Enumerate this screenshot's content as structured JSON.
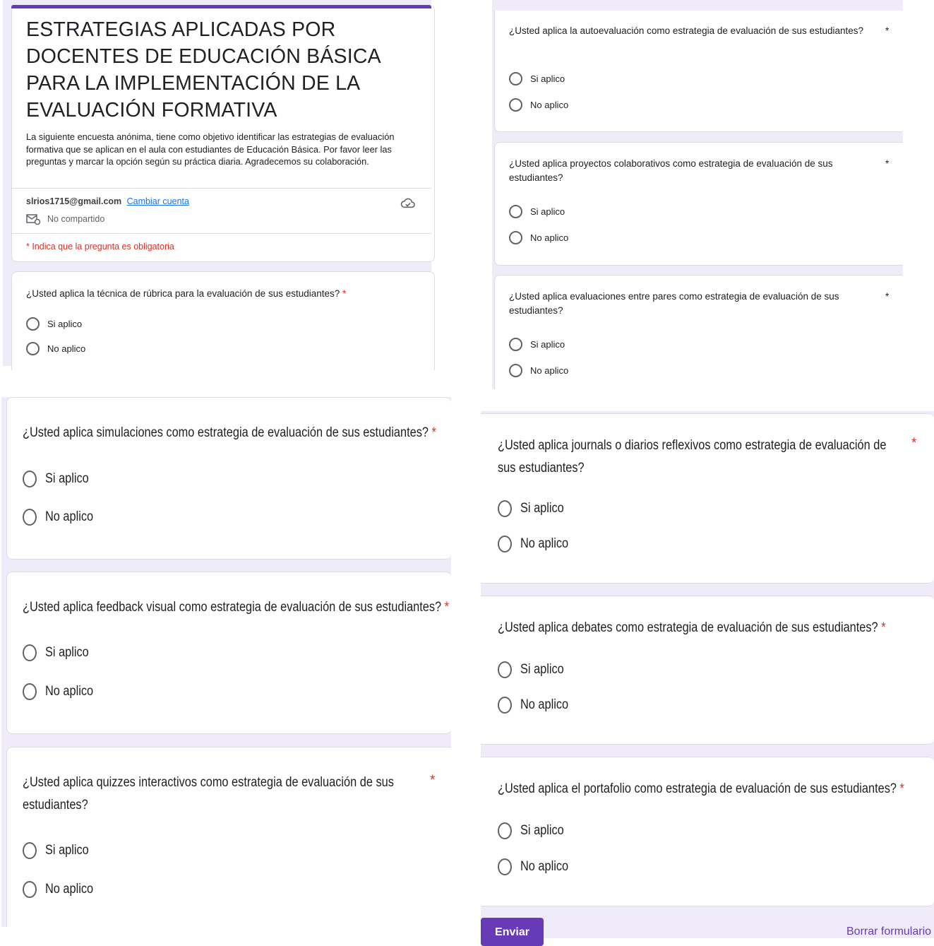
{
  "header": {
    "title": "ESTRATEGIAS APLICADAS POR DOCENTES DE EDUCACIÓN BÁSICA PARA LA IMPLEMENTACIÓN  DE LA EVALUACIÓN FORMATIVA",
    "description": "La siguiente encuesta anónima, tiene como  objetivo identificar las estrategias de evaluación formativa que se aplican en el aula con estudiantes de Educación Básica. Por favor leer las preguntas y marcar la opción según su práctica diaria. Agradecemos su colaboración.",
    "email": "slrios1715@gmail.com",
    "switch_account": "Cambiar cuenta",
    "not_shared": "No compartido",
    "required_note": "* Indica que la pregunta es obligatoria"
  },
  "questions": [
    {
      "text": "¿Usted  aplica la técnica de rúbrica para la evaluación de sus estudiantes?",
      "required": "*",
      "options": [
        "Si aplico",
        "No aplico"
      ]
    },
    {
      "text": "¿Usted  aplica la autoevaluación como estrategia de evaluación de sus estudiantes?",
      "required": "*",
      "options": [
        "Si aplico",
        "No aplico"
      ]
    },
    {
      "text": "¿Usted aplica proyectos colaborativos como estrategia de evaluación de sus estudiantes?",
      "required": "*",
      "options": [
        "Si aplico",
        "No aplico"
      ]
    },
    {
      "text": "¿Usted aplica evaluaciones entre pares como estrategia de evaluación de sus estudiantes?",
      "required": "*",
      "options": [
        "Si aplico",
        "No aplico"
      ]
    },
    {
      "text": "¿Usted aplica simulaciones como estrategia de evaluación de sus estudiantes?",
      "required": "*",
      "options": [
        "Si aplico",
        "No aplico"
      ]
    },
    {
      "text": "¿Usted aplica feedback visual como estrategia de evaluación de sus estudiantes?",
      "required": "*",
      "options": [
        "Si aplico",
        "No aplico"
      ]
    },
    {
      "text": "¿Usted aplica quizzes interactivos como estrategia de evaluación de sus estudiantes?",
      "required": "*",
      "options": [
        "Si aplico",
        "No aplico"
      ]
    },
    {
      "text": "¿Usted aplica journals  o diarios reflexivos como estrategia de evaluación de sus estudiantes?",
      "required": "*",
      "options": [
        "Si aplico",
        "No aplico"
      ]
    },
    {
      "text": "¿Usted aplica debates como estrategia de evaluación de sus estudiantes?",
      "required": "*",
      "options": [
        "Si aplico",
        "No aplico"
      ]
    },
    {
      "text": "¿Usted aplica el portafolio como estrategia de evaluación de sus estudiantes?",
      "required": "*",
      "options": [
        "Si aplico",
        "No aplico"
      ]
    }
  ],
  "footer": {
    "submit": "Enviar",
    "clear": "Borrar formulario"
  },
  "colors": {
    "accent": "#673ab7",
    "background": "#f0ebf8",
    "required": "#d93025",
    "link": "#1a73e8"
  }
}
